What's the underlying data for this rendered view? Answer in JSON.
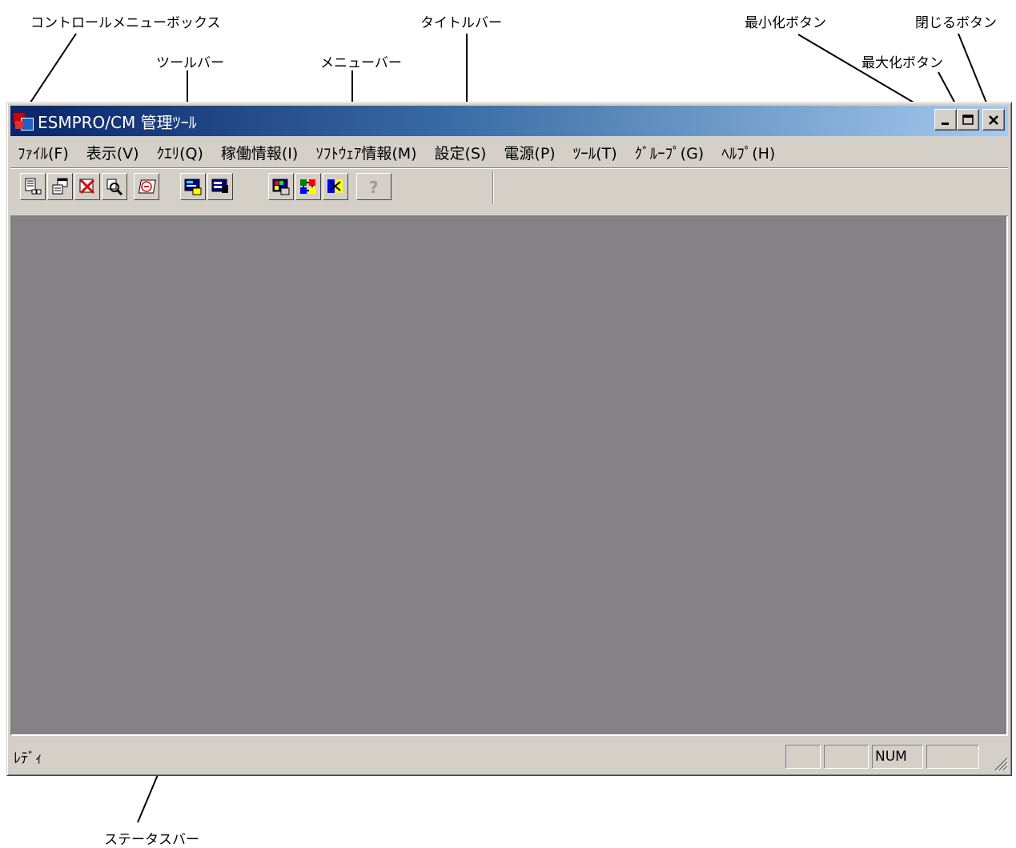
{
  "callouts": {
    "control_menu_box": "コントロールメニューボックス",
    "title_bar": "タイトルバー",
    "minimize_button": "最小化ボタン",
    "close_button": "閉じるボタン",
    "toolbar": "ツールバー",
    "menu_bar": "メニューバー",
    "maximize_button": "最大化ボタン",
    "status_bar": "ステータスバー"
  },
  "window": {
    "title": "ESMPRO/CM 管理ﾂｰﾙ"
  },
  "menu": [
    {
      "label": "ﾌｧｲﾙ(F)"
    },
    {
      "label": "表示(V)"
    },
    {
      "label": "ｸｴﾘ(Q)"
    },
    {
      "label": "稼働情報(I)"
    },
    {
      "label": "ｿﾌﾄｳｪｱ情報(M)"
    },
    {
      "label": "設定(S)"
    },
    {
      "label": "電源(P)"
    },
    {
      "label": "ﾂｰﾙ(T)"
    },
    {
      "label": "ｸﾞﾙｰﾌﾟ(G)"
    },
    {
      "label": "ﾍﾙﾌﾟ(H)"
    }
  ],
  "toolbar_icons": [
    "tree-view-icon",
    "properties-icon",
    "delete-icon",
    "search-icon",
    "sg-icon",
    "screen-info-icon",
    "monitor-icon",
    "resource-icon",
    "network-icon",
    "group-icon",
    "help-icon"
  ],
  "status": {
    "text": "ﾚﾃﾞｨ",
    "num_indicator": "NUM"
  },
  "colors": {
    "title_gradient_start": "#0a246a",
    "title_gradient_end": "#a6caf0",
    "workspace": "#858286",
    "chrome": "#d4d0c8"
  }
}
